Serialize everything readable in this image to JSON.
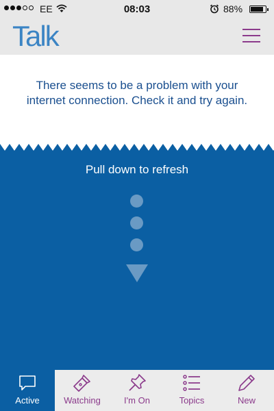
{
  "status_bar": {
    "carrier": "EE",
    "time": "08:03",
    "battery_percent": "88%",
    "battery_level": 0.88,
    "signal_bars_filled": 3,
    "signal_bars_total": 5
  },
  "header": {
    "logo": "Talk"
  },
  "error": {
    "message": "There seems to be a problem with your internet connection. Check it and try again."
  },
  "refresh": {
    "label": "Pull down to refresh"
  },
  "tabs": [
    {
      "label": "Active",
      "icon": "speech-bubble-icon",
      "active": true
    },
    {
      "label": "Watching",
      "icon": "flashlight-icon",
      "active": false
    },
    {
      "label": "I'm On",
      "icon": "pushpin-icon",
      "active": false
    },
    {
      "label": "Topics",
      "icon": "list-icon",
      "active": false
    },
    {
      "label": "New",
      "icon": "pencil-icon",
      "active": false
    }
  ],
  "colors": {
    "brand_blue": "#0b5fa3",
    "logo_blue": "#3b84c4",
    "accent_purple": "#8b3a8b",
    "error_text": "#1a4f8f"
  }
}
